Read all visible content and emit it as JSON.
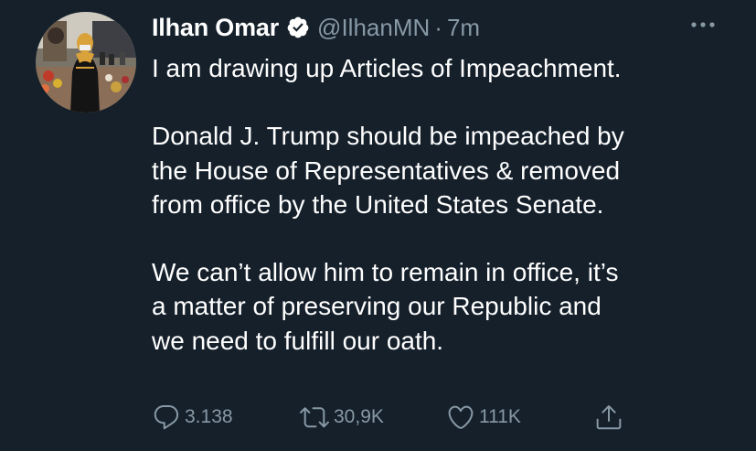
{
  "tweet": {
    "author": {
      "name": "Ilhan Omar",
      "handle": "@IlhanMN",
      "verified": true,
      "avatar_icon": "profile-photo"
    },
    "separator": "·",
    "time": "7m",
    "more_icon": "more-horizontal-icon",
    "paragraphs": [
      [
        "I am drawing up Articles of Impeachment."
      ],
      [
        "Donald J. Trump should be impeached by",
        "the House of Representatives & removed",
        "from office by the United States Senate."
      ],
      [
        "We can’t allow him to remain in office, it’s",
        "a matter of preserving our Republic and",
        "we need to fulfill our oath."
      ]
    ],
    "actions": {
      "reply": {
        "icon": "reply-icon",
        "count": "3.138"
      },
      "retweet": {
        "icon": "retweet-icon",
        "count": "30,9K"
      },
      "like": {
        "icon": "heart-icon",
        "count": "111K"
      },
      "share": {
        "icon": "share-icon"
      }
    }
  },
  "colors": {
    "background": "#15202b",
    "text": "#ffffff",
    "secondary": "#8899a6"
  }
}
